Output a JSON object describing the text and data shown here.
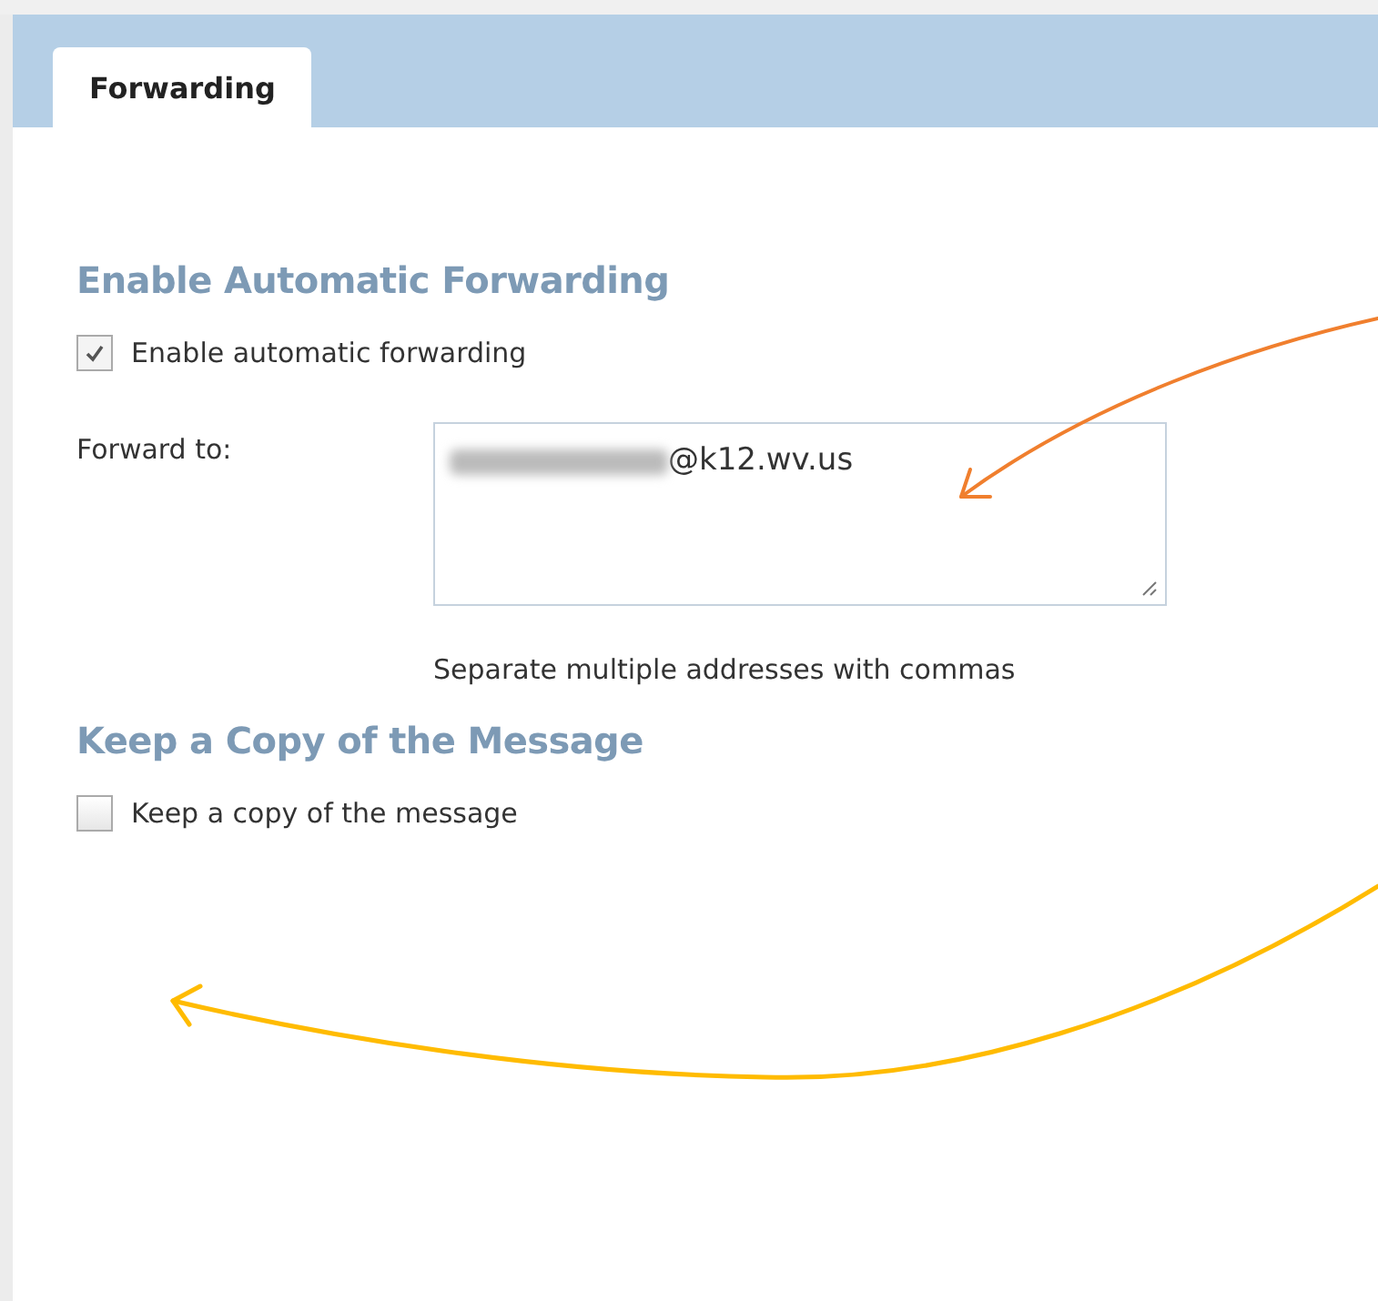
{
  "tabs": [
    {
      "label": "Forwarding",
      "selected": true
    }
  ],
  "sections": [
    {
      "heading": "Enable Automatic Forwarding",
      "checkbox": {
        "label": "Enable automatic forwarding",
        "checked": true
      },
      "field": {
        "label": "Forward to:",
        "value": "@k12.wv.us",
        "redacted": true,
        "hint": "Separate multiple addresses with commas"
      }
    },
    {
      "heading": "Keep a Copy of the Message",
      "checkbox": {
        "label": "Keep a copy of the message",
        "checked": false
      }
    }
  ]
}
